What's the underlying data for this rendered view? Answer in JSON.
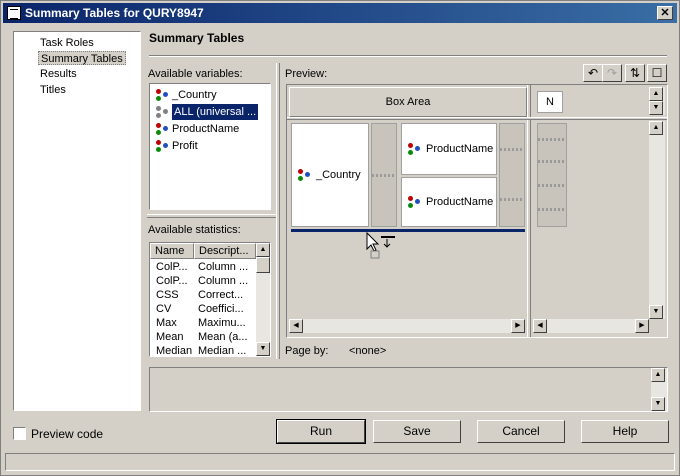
{
  "window": {
    "title": "Summary Tables for QURY8947"
  },
  "nav": {
    "items": [
      "Task Roles",
      "Summary Tables",
      "Results",
      "Titles"
    ],
    "selected_index": 1
  },
  "page": {
    "heading": "Summary Tables"
  },
  "variables": {
    "label": "Available variables:",
    "items": [
      "_Country",
      "ALL (universal ...",
      "ProductName",
      "Profit"
    ],
    "selected_index": 1
  },
  "statistics": {
    "label": "Available statistics:",
    "col_name": "Name",
    "col_desc": "Descript...",
    "rows": [
      [
        "ColP...",
        "Column ..."
      ],
      [
        "ColP...",
        "Column ..."
      ],
      [
        "CSS",
        "Correct..."
      ],
      [
        "CV",
        "Coeffici..."
      ],
      [
        "Max",
        "Maximu..."
      ],
      [
        "Mean",
        "Mean (a..."
      ],
      [
        "Median",
        "Median ..."
      ]
    ]
  },
  "preview": {
    "label": "Preview:",
    "box_area": "Box Area",
    "col_header": "N",
    "row_var": "_Country",
    "cells": [
      "ProductName",
      "ProductName"
    ],
    "page_by_label": "Page by:",
    "page_by_value": "<none>"
  },
  "footer": {
    "preview_code": "Preview code",
    "buttons": [
      "Run",
      "Save",
      "Cancel",
      "Help"
    ]
  },
  "icons": [
    "close-icon",
    "undo-icon",
    "redo-icon",
    "swap-icon",
    "maximize-icon",
    "variable-icon"
  ]
}
